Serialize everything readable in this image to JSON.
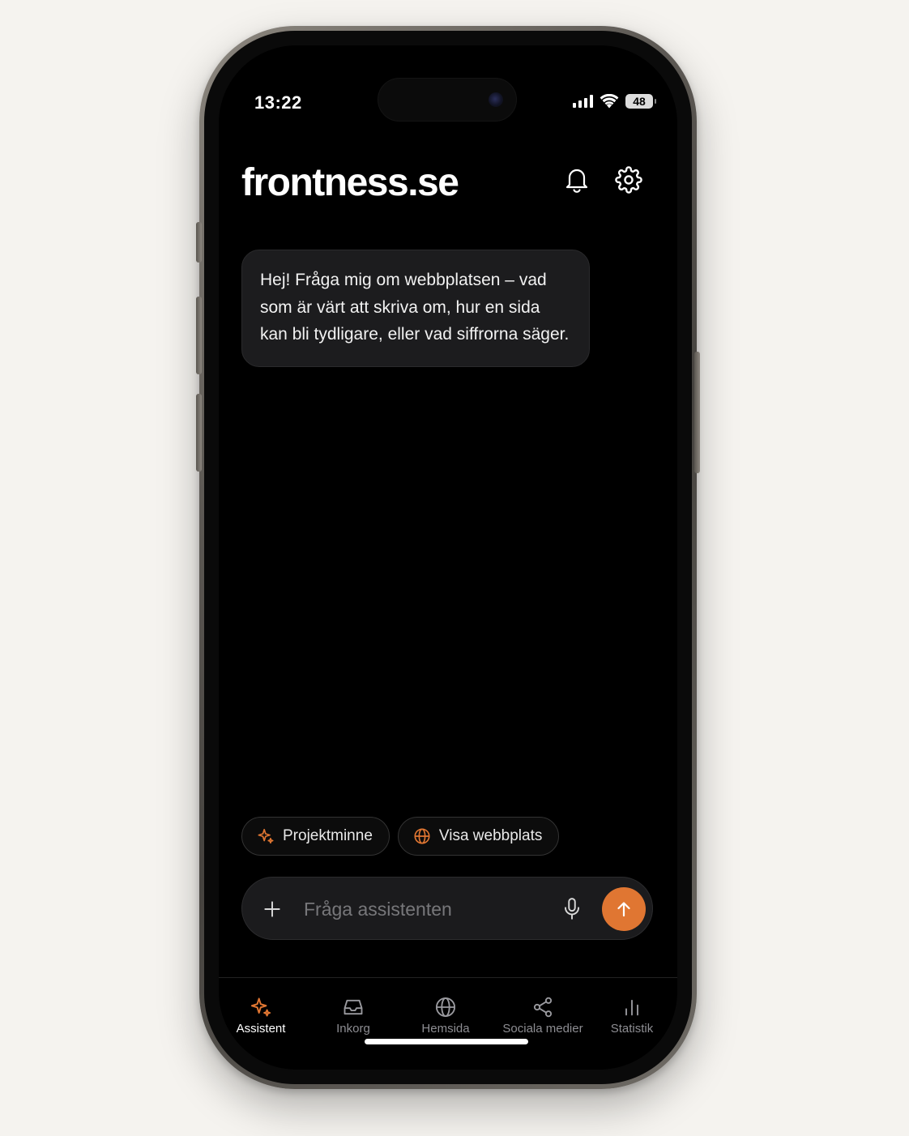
{
  "status_bar": {
    "time": "13:22",
    "battery": "48"
  },
  "header": {
    "brand": "frontness.se",
    "icons": [
      "bell-icon",
      "gear-icon"
    ]
  },
  "chat": {
    "messages": [
      {
        "role": "assistant",
        "text": "Hej! Fråga mig om webbplatsen – vad som är värt att skriva om, hur en sida kan bli tydligare, eller vad siffrorna säger."
      }
    ]
  },
  "chips": [
    {
      "label": "Projektminne",
      "icon": "sparkle-icon"
    },
    {
      "label": "Visa webbplats",
      "icon": "globe-icon"
    }
  ],
  "composer": {
    "placeholder": "Fråga assistenten",
    "value": ""
  },
  "tabs": [
    {
      "label": "Assistent",
      "icon": "sparkle-icon",
      "active": true
    },
    {
      "label": "Inkorg",
      "icon": "inbox-icon",
      "active": false
    },
    {
      "label": "Hemsida",
      "icon": "globe-icon",
      "active": false
    },
    {
      "label": "Sociala medier",
      "icon": "share-icon",
      "active": false
    },
    {
      "label": "Statistik",
      "icon": "bar-chart-icon",
      "active": false
    }
  ],
  "colors": {
    "accent": "#e07632",
    "background": "#000000",
    "bubble": "#1c1c1e",
    "page": "#f5f3ef"
  }
}
